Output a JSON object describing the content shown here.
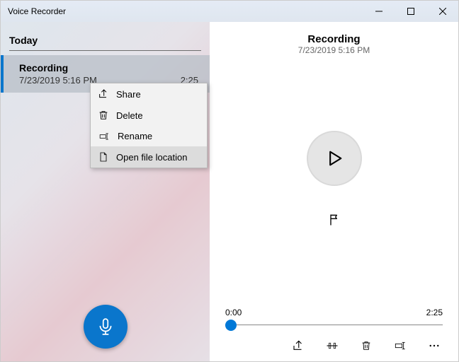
{
  "titlebar": {
    "title": "Voice Recorder"
  },
  "sidebar": {
    "section": "Today",
    "item": {
      "name": "Recording",
      "datetime": "7/23/2019 5:16 PM",
      "duration": "2:25"
    }
  },
  "main": {
    "title": "Recording",
    "subtitle": "7/23/2019 5:16 PM",
    "time_start": "0:00",
    "time_end": "2:25"
  },
  "context_menu": {
    "items": [
      {
        "icon": "share-icon",
        "label": "Share"
      },
      {
        "icon": "trash-icon",
        "label": "Delete"
      },
      {
        "icon": "rename-icon",
        "label": "Rename"
      },
      {
        "icon": "file-location-icon",
        "label": "Open file location"
      }
    ],
    "highlighted_index": 3
  },
  "toolbar_icons": [
    "share-icon",
    "trim-icon",
    "trash-icon",
    "rename-icon",
    "more-icon"
  ]
}
